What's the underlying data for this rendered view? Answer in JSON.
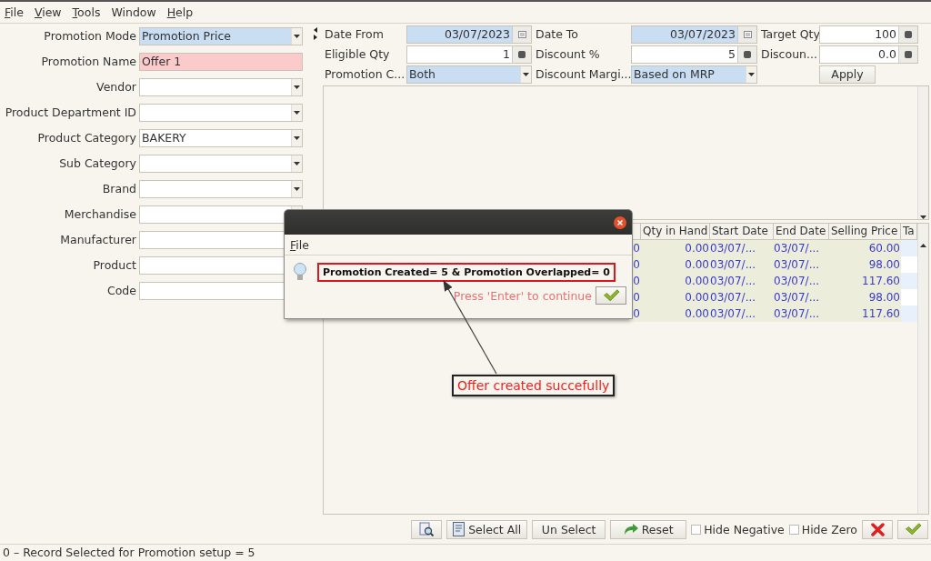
{
  "menu": [
    {
      "label": "File",
      "mnemonic": true
    },
    {
      "label": "View",
      "mnemonic": true
    },
    {
      "label": "Tools",
      "mnemonic": true
    },
    {
      "label": "Window",
      "mnemonic": false
    },
    {
      "label": "Help",
      "mnemonic": true
    }
  ],
  "left_form": [
    {
      "label": "Promotion Mode",
      "value": "Promotion Price",
      "kind": "combo",
      "focused": true,
      "invalid": false
    },
    {
      "label": "Promotion Name",
      "value": "Offer 1",
      "kind": "text",
      "focused": false,
      "invalid": true
    },
    {
      "label": "Vendor",
      "kind": "combo",
      "focused": false,
      "invalid": false
    },
    {
      "label": "Product Department ID",
      "kind": "combo",
      "focused": false,
      "invalid": false
    },
    {
      "label": "Product Category",
      "value": "BAKERY",
      "kind": "combo",
      "focused": false,
      "invalid": false
    },
    {
      "label": "Sub Category",
      "kind": "combo",
      "focused": false,
      "invalid": false
    },
    {
      "label": "Brand",
      "kind": "combo",
      "focused": false,
      "invalid": false
    },
    {
      "label": "Merchandise",
      "kind": "combo",
      "focused": false,
      "invalid": false
    },
    {
      "label": "Manufacturer",
      "kind": "text",
      "focused": false,
      "invalid": false
    },
    {
      "label": "Product",
      "kind": "text",
      "focused": false,
      "invalid": false
    },
    {
      "label": "Code",
      "kind": "text",
      "focused": false,
      "invalid": false
    }
  ],
  "top_form": [
    {
      "label": "Date From",
      "value": "03/07/2023",
      "kind": "date"
    },
    {
      "label": "Date To",
      "value": "03/07/2023",
      "kind": "date"
    },
    {
      "label": "Target Qty",
      "value": "100",
      "kind": "spinner"
    },
    {
      "label": "Eligible Qty",
      "value": "1",
      "kind": "spinner"
    },
    {
      "label": "Discount %",
      "value": "5",
      "kind": "spinner"
    },
    {
      "label": "Discoun...",
      "value": "0.0",
      "kind": "spinner"
    },
    {
      "label": "Promotion C...",
      "value": "Both",
      "kind": "combo"
    },
    {
      "label": "Discount Margi...",
      "value": "Based on MRP",
      "kind": "combo"
    },
    {
      "label": "Apply",
      "kind": "button"
    }
  ],
  "table": {
    "columns": [
      "",
      "Qty in Hand",
      "Start Date",
      "End Date",
      "Selling Price",
      "Ta"
    ],
    "rows": [
      [
        "0",
        "0.00",
        "03/07/...",
        "03/07/...",
        "60.00",
        ""
      ],
      [
        "0",
        "0.00",
        "03/07/...",
        "03/07/...",
        "98.00",
        ""
      ],
      [
        "0",
        "0.00",
        "03/07/...",
        "03/07/...",
        "117.60",
        ""
      ],
      [
        "0",
        "0.00",
        "03/07/...",
        "03/07/...",
        "98.00",
        ""
      ],
      [
        "0",
        "0.00",
        "03/07/...",
        "03/07/...",
        "117.60",
        ""
      ]
    ]
  },
  "dialog": {
    "menu": "File",
    "message": "Promotion Created= 5 & Promotion Overlapped= 0",
    "hint": "Press 'Enter' to continue"
  },
  "annotation": {
    "text": "Offer created succefully"
  },
  "toolbar": [
    {
      "kind": "preview"
    },
    {
      "kind": "select",
      "label": "Select All"
    },
    {
      "kind": "plain",
      "label": "Un Select"
    },
    {
      "kind": "reset",
      "label": "Reset"
    },
    {
      "kind": "check",
      "label": "Hide Negative",
      "checked": false
    },
    {
      "kind": "check",
      "label": "Hide Zero",
      "checked": false
    },
    {
      "kind": "cancel"
    },
    {
      "kind": "ok"
    }
  ],
  "status_bar": "0 – Record Selected for Promotion setup = 5"
}
